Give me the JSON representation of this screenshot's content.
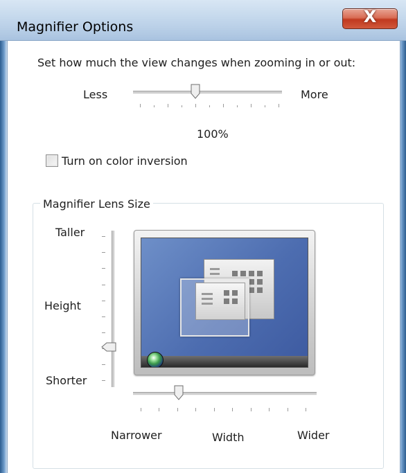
{
  "window": {
    "title": "Magnifier Options",
    "close_glyph": "X"
  },
  "zoom": {
    "prompt": "Set how much the view changes when zooming in or out:",
    "less_label": "Less",
    "more_label": "More",
    "value_text": "100%",
    "slider_position": 0.45
  },
  "inversion": {
    "label": "Turn on color inversion",
    "checked": false
  },
  "lens": {
    "group_title": "Magnifier Lens Size",
    "taller_label": "Taller",
    "height_label": "Height",
    "shorter_label": "Shorter",
    "narrower_label": "Narrower",
    "width_label": "Width",
    "wider_label": "Wider",
    "height_position": 0.15,
    "width_position": 0.25
  },
  "icons": [
    "close-icon",
    "checkbox-icon",
    "start-orb-icon",
    "monitor-preview-icon"
  ],
  "colors": {
    "titlebar": "#c4d8ec",
    "close_button": "#c0391f",
    "screen": "#4d6db0"
  }
}
